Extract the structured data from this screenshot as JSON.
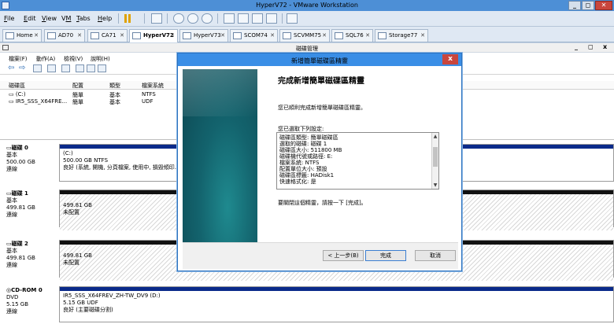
{
  "vmware": {
    "title": "HyperV72 - VMware Workstation",
    "menu": [
      "File",
      "Edit",
      "View",
      "VM",
      "Tabs",
      "Help"
    ],
    "menu_mnemonics": [
      "F",
      "E",
      "V",
      "M",
      "T",
      "H"
    ],
    "controls": {
      "minimize": "_",
      "maximize": "◻",
      "close": "✕"
    }
  },
  "tabs": [
    {
      "label": "Home"
    },
    {
      "label": "AD70"
    },
    {
      "label": "CA71"
    },
    {
      "label": "HyperV72",
      "active": true
    },
    {
      "label": "HyperV73"
    },
    {
      "label": "SCOM74"
    },
    {
      "label": "SCVMM75"
    },
    {
      "label": "SQL76"
    },
    {
      "label": "Storage77"
    }
  ],
  "tab_close": "✕",
  "disk_mgmt": {
    "title": "磁碟管理",
    "controls": {
      "minimize": "_",
      "maximize": "◻",
      "close": "x"
    },
    "menu": [
      "檔案(F)",
      "動作(A)",
      "檢視(V)",
      "說明(H)"
    ],
    "volume_columns": [
      "磁碟區",
      "配置",
      "類型",
      "檔案系統"
    ],
    "volumes": [
      {
        "name": "(C:)",
        "layout": "簡單",
        "type": "基本",
        "fs": "NTFS"
      },
      {
        "name": "IR5_SSS_X64FRE...",
        "layout": "簡單",
        "type": "基本",
        "fs": "UDF"
      }
    ],
    "disks": [
      {
        "name": "磁碟 0",
        "type": "基本",
        "size": "500.00 GB",
        "status": "連線",
        "part": {
          "title": "(C:)",
          "size": "500.00 GB NTFS",
          "status": "良好 (系統, 開機, 分頁檔案, 使用中, 損毀傾印..."
        }
      },
      {
        "name": "磁碟 1",
        "type": "基本",
        "size": "499.81 GB",
        "status": "連線",
        "part": {
          "size": "499.81 GB",
          "status": "未配置"
        }
      },
      {
        "name": "磁碟 2",
        "type": "基本",
        "size": "499.81 GB",
        "status": "連線",
        "part": {
          "size": "499.81 GB",
          "status": "未配置"
        }
      },
      {
        "name": "CD-ROM 0",
        "type": "DVD",
        "size": "5.15 GB",
        "status": "連線",
        "part": {
          "title": "IR5_SSS_X64FREV_ZH-TW_DV9 (D:)",
          "size": "5.15 GB UDF",
          "status": "良好 (主要磁碟分割)"
        }
      }
    ]
  },
  "wizard": {
    "title": "新增簡單磁碟區精靈",
    "close": "x",
    "heading": "完成新增簡單磁碟區精靈",
    "success_text": "您已順利完成新增簡單磁碟區精靈。",
    "settings_label": "您已選取下列設定:",
    "settings": [
      "磁碟區類型: 簡單磁碟區",
      "選取的磁碟: 磁碟 1",
      "磁碟區大小: 511800 MB",
      "磁碟機代號或路徑: E:",
      "檔案系統: NTFS",
      "配置單位大小: 預設",
      "磁碟區標籤: HADisk1",
      "快速格式化: 是"
    ],
    "close_hint": "要關閉這個精靈，請按一下 [完成]。",
    "buttons": {
      "back": "< 上一步(B)",
      "finish": "完成",
      "cancel": "取消"
    }
  }
}
